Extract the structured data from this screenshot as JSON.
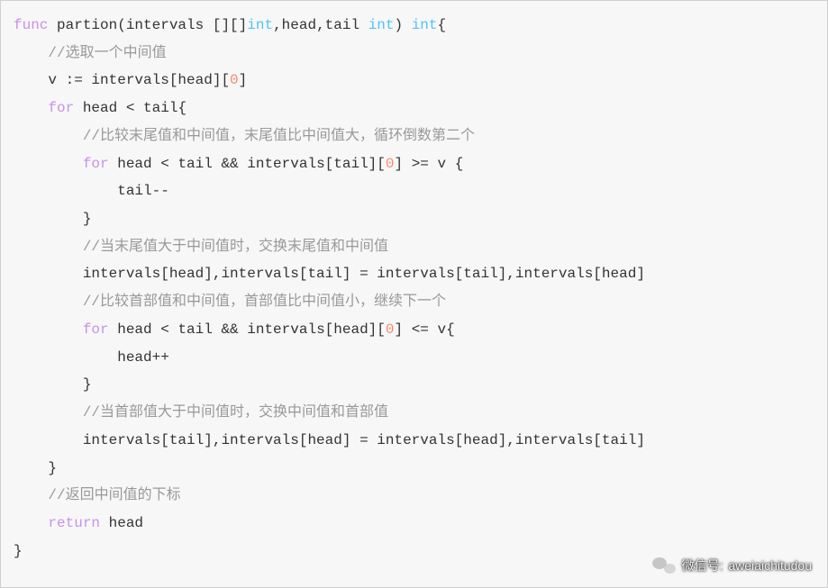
{
  "code": {
    "lines": [
      {
        "indent": 0,
        "segments": [
          {
            "t": "kw",
            "v": "func"
          },
          {
            "t": "punct",
            "v": " partion(intervals [][]"
          },
          {
            "t": "type",
            "v": "int"
          },
          {
            "t": "punct",
            "v": ",head,tail "
          },
          {
            "t": "type",
            "v": "int"
          },
          {
            "t": "punct",
            "v": ") "
          },
          {
            "t": "type",
            "v": "int"
          },
          {
            "t": "punct",
            "v": "{"
          }
        ]
      },
      {
        "indent": 1,
        "segments": [
          {
            "t": "comment",
            "v": "//选取一个中间值"
          }
        ]
      },
      {
        "indent": 1,
        "segments": [
          {
            "t": "ident",
            "v": "v := intervals[head]["
          },
          {
            "t": "num",
            "v": "0"
          },
          {
            "t": "ident",
            "v": "]"
          }
        ]
      },
      {
        "indent": 1,
        "segments": [
          {
            "t": "kw",
            "v": "for"
          },
          {
            "t": "ident",
            "v": " head < tail{"
          }
        ]
      },
      {
        "indent": 2,
        "segments": [
          {
            "t": "comment",
            "v": "//比较末尾值和中间值，末尾值比中间值大，循环倒数第二个"
          }
        ]
      },
      {
        "indent": 2,
        "segments": [
          {
            "t": "kw",
            "v": "for"
          },
          {
            "t": "ident",
            "v": " head < tail && intervals[tail]["
          },
          {
            "t": "num",
            "v": "0"
          },
          {
            "t": "ident",
            "v": "] >= v {"
          }
        ]
      },
      {
        "indent": 3,
        "segments": [
          {
            "t": "ident",
            "v": "tail--"
          }
        ]
      },
      {
        "indent": 2,
        "segments": [
          {
            "t": "ident",
            "v": "}"
          }
        ]
      },
      {
        "indent": 2,
        "segments": [
          {
            "t": "comment",
            "v": "//当末尾值大于中间值时，交换末尾值和中间值"
          }
        ]
      },
      {
        "indent": 2,
        "segments": [
          {
            "t": "ident",
            "v": "intervals[head],intervals[tail] = intervals[tail],intervals[head]"
          }
        ]
      },
      {
        "indent": 2,
        "segments": [
          {
            "t": "comment",
            "v": "//比较首部值和中间值，首部值比中间值小，继续下一个"
          }
        ]
      },
      {
        "indent": 2,
        "segments": [
          {
            "t": "kw",
            "v": "for"
          },
          {
            "t": "ident",
            "v": " head < tail && intervals[head]["
          },
          {
            "t": "num",
            "v": "0"
          },
          {
            "t": "ident",
            "v": "] <= v{"
          }
        ]
      },
      {
        "indent": 3,
        "segments": [
          {
            "t": "ident",
            "v": "head++"
          }
        ]
      },
      {
        "indent": 2,
        "segments": [
          {
            "t": "ident",
            "v": "}"
          }
        ]
      },
      {
        "indent": 2,
        "segments": [
          {
            "t": "comment",
            "v": "//当首部值大于中间值时，交换中间值和首部值"
          }
        ]
      },
      {
        "indent": 2,
        "segments": [
          {
            "t": "ident",
            "v": "intervals[tail],intervals[head] = intervals[head],intervals[tail]"
          }
        ]
      },
      {
        "indent": 1,
        "segments": [
          {
            "t": "ident",
            "v": "}"
          }
        ]
      },
      {
        "indent": 1,
        "segments": [
          {
            "t": "comment",
            "v": "//返回中间值的下标"
          }
        ]
      },
      {
        "indent": 1,
        "segments": [
          {
            "t": "kw",
            "v": "return"
          },
          {
            "t": "ident",
            "v": " head"
          }
        ]
      },
      {
        "indent": 0,
        "segments": [
          {
            "t": "ident",
            "v": "}"
          }
        ]
      }
    ]
  },
  "watermark": {
    "label": "微信号:",
    "value": "aweiaichitudou"
  }
}
